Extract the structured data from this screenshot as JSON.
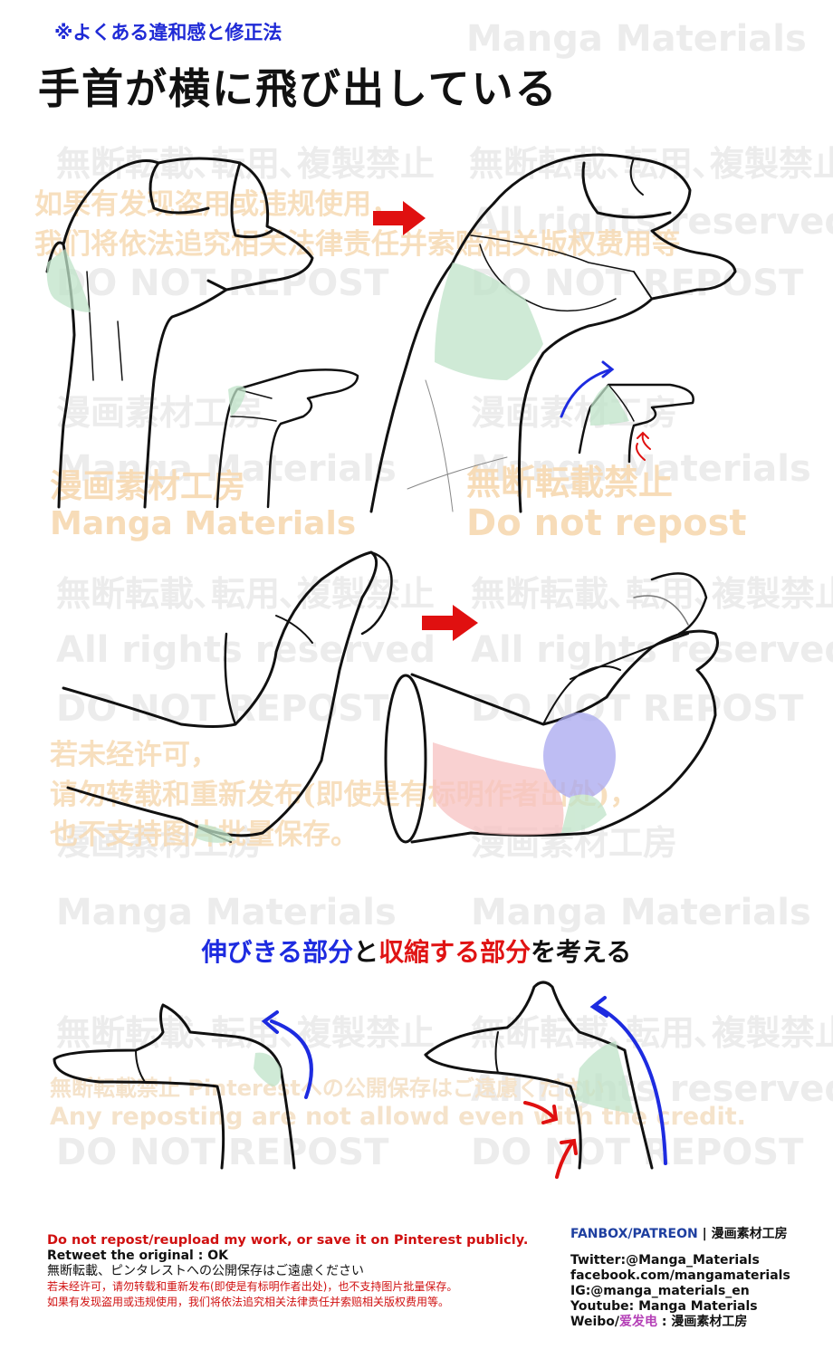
{
  "header": {
    "subtitle": "※よくある違和感と修正法",
    "title": "手首が横に飛び出している"
  },
  "watermarks": {
    "manga_materials": "Manga Materials",
    "no_repost_jp": "無断転載､転用､複製禁止",
    "all_rights": "All rights reserved",
    "do_not_repost": "DO NOT REPOST",
    "studio_jp": "漫画素材工房",
    "no_repost_short_jp": "無断転載禁止",
    "do_not_repost_lower": "Do not repost",
    "cn_line1": "如果有发现盗用或违规使用，",
    "cn_line2": "我们将依法追究相关法律责任并索赔相关版权费用等",
    "cn_b_line1": "若未经许可，",
    "cn_b_line2": "请勿转载和重新发布(即使是有标明作者出处)，",
    "cn_b_line3": "也不支持图片批量保存。",
    "pinterest_jp": "無断転載禁止 Pinterestへの公開保存はご遠慮ください",
    "any_reposting": "Any reposting are not allowd even with the credit."
  },
  "caption": {
    "part1": "伸びきる部分",
    "part2": "と",
    "part3": "収縮する部分",
    "part4": "を考える"
  },
  "footer": {
    "left": {
      "line1": "Do not repost/reupload my work, or save it on Pinterest publicly.",
      "line2": "Retweet the original : OK",
      "line3": "無断転載、ピンタレストへの公開保存はご遠慮ください",
      "line4": "若未经许可，请勿转载和重新发布(即使是有标明作者出处)，也不支持图片批量保存。",
      "line5": "如果有发现盗用或违规使用，我们将依法追究相关法律责任并索赔相关版权费用等。"
    },
    "right": {
      "fanbox_label": "FANBOX/PATREON",
      "fanbox_sep": " | ",
      "fanbox_name": "漫画素材工房",
      "twitter": "Twitter:@Manga_Materials",
      "facebook": "facebook.com/mangamaterials",
      "ig": "IG:@manga_materials_en",
      "youtube": "Youtube: Manga Materials",
      "weibo_prefix": "Weibo/",
      "weibo_mid": "爱发电",
      "weibo_suffix": " : 漫画素材工房"
    }
  },
  "colors": {
    "arrow_red": "#e01010",
    "arrow_blue": "#1d2be0",
    "highlight_green": "#bfe3c8",
    "highlight_blue": "#a9a8f0",
    "highlight_pink": "#f7c2c2"
  }
}
